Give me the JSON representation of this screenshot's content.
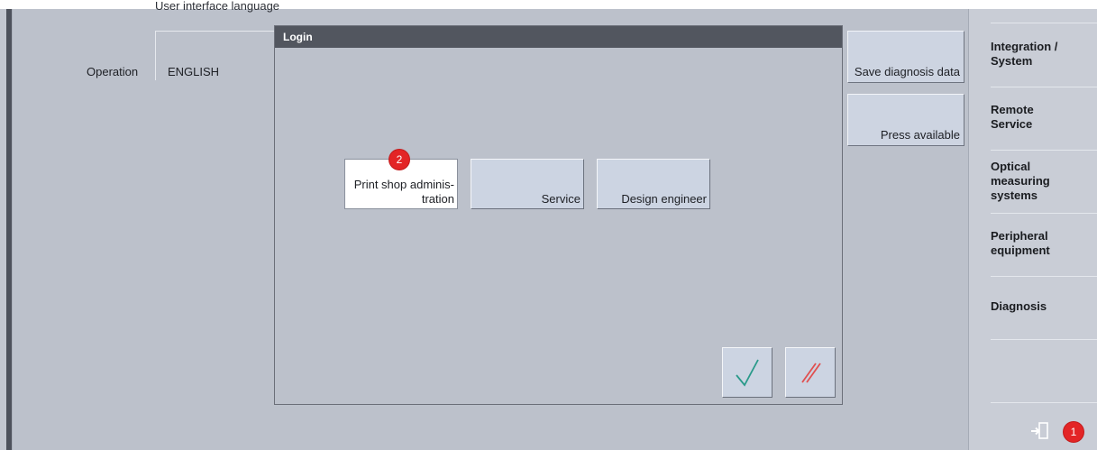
{
  "settings": {
    "section_label": "User interface language",
    "row_label": "Operation",
    "language_value": "ENGLISH"
  },
  "side_buttons": {
    "save_diagnosis": "Save diagnosis data",
    "press_available": "Press available"
  },
  "nav_tabs": [
    {
      "label_l1": "Integration /",
      "label_l2": "System"
    },
    {
      "label_l1": "Remote",
      "label_l2": "Service"
    },
    {
      "label_l1": "Optical",
      "label_l2": "measuring",
      "label_l3": "systems"
    },
    {
      "label_l1": "Peripheral",
      "label_l2": "equipment"
    },
    {
      "label_l1": "Diagnosis"
    }
  ],
  "dialog": {
    "title": "Login",
    "roles": [
      {
        "label_l1": "Print shop adminis-",
        "label_l2": "tration",
        "selected": true
      },
      {
        "label_l1": "Service",
        "selected": false
      },
      {
        "label_l1": "Design engineer",
        "selected": false
      }
    ],
    "confirm_icon": "checkmark-icon",
    "cancel_icon": "cancel-slashes-icon"
  },
  "badges": {
    "exit_badge": "1",
    "role_badge": "2"
  },
  "icons": {
    "exit": "logout-door-icon"
  },
  "colors": {
    "badge": "#e32526",
    "title_bar": "#52565f",
    "confirm": "#2a9a8a",
    "cancel": "#e05050"
  }
}
